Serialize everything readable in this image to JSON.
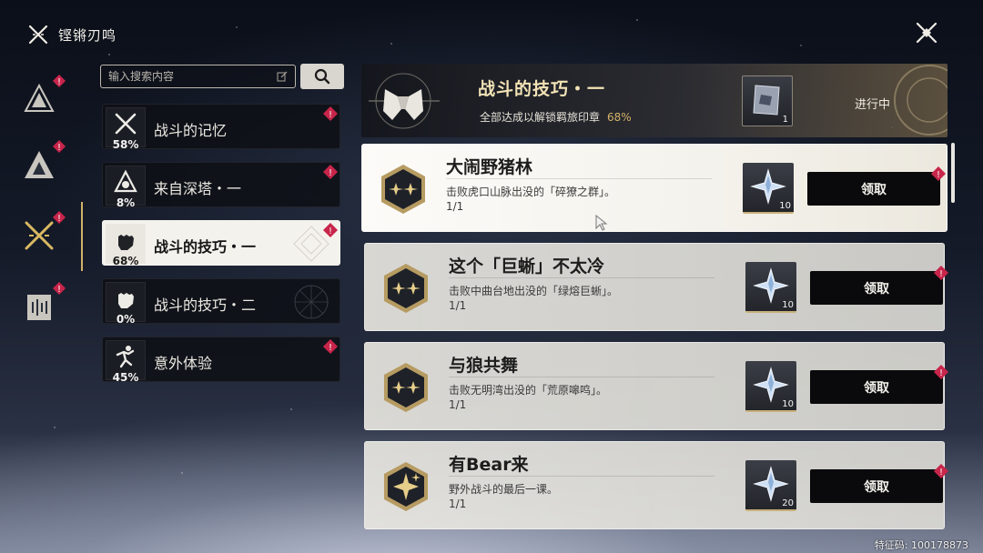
{
  "header": {
    "title": "铿锵刃鸣"
  },
  "search": {
    "placeholder": "输入搜索内容"
  },
  "categories": [
    {
      "label": "战斗的记忆",
      "percent": "58%",
      "icon": "crossed-swords-icon",
      "active": false
    },
    {
      "label": "来自深塔・一",
      "percent": "8%",
      "icon": "tower-icon",
      "active": false
    },
    {
      "label": "战斗的技巧・一",
      "percent": "68%",
      "icon": "fist-icon",
      "active": true
    },
    {
      "label": "战斗的技巧・二",
      "percent": "0%",
      "icon": "fist-icon",
      "active": false
    },
    {
      "label": "意外体验",
      "percent": "45%",
      "icon": "running-figure-icon",
      "active": false
    }
  ],
  "detail": {
    "title": "战斗的技巧・一",
    "subtitle": "全部达成以解锁羁旅印章",
    "percent": "68%",
    "reward_count": "1",
    "status": "进行中"
  },
  "tasks": [
    {
      "title": "大闹野猪林",
      "desc": "击败虎口山脉出没的「碎獠之群」。",
      "progress": "1/1",
      "reward_count": "10",
      "button": "领取"
    },
    {
      "title": "这个「巨蜥」不太冷",
      "desc": "击败中曲台地出没的「绿熔巨蜥」。",
      "progress": "1/1",
      "reward_count": "10",
      "button": "领取"
    },
    {
      "title": "与狼共舞",
      "desc": "击败无明湾出没的「荒原嗥鸣」。",
      "progress": "1/1",
      "reward_count": "10",
      "button": "领取"
    },
    {
      "title": "有Bear来",
      "desc": "野外战斗的最后一课。",
      "progress": "1/1",
      "reward_count": "20",
      "button": "领取"
    }
  ],
  "footer": {
    "feature_code": "特征码: 100178873"
  },
  "colors": {
    "accent_gold": "#d4b368",
    "badge_red": "#c8254a",
    "active_rail": "#d2b16a"
  }
}
